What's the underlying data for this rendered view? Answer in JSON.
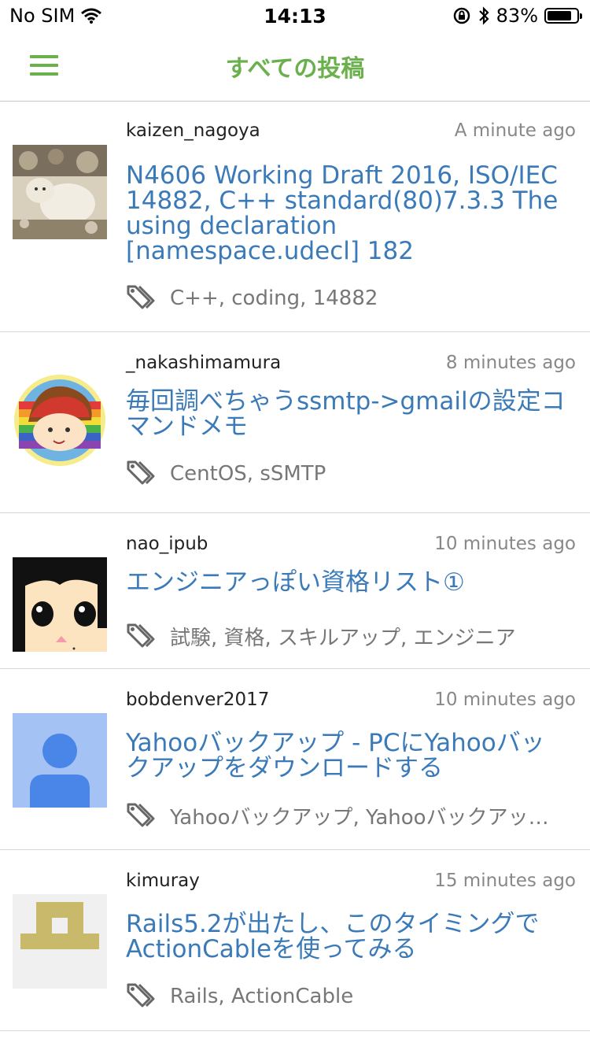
{
  "status": {
    "carrier": "No SIM",
    "time": "14:13",
    "battery": "83%",
    "battery_level": 0.83
  },
  "nav": {
    "title": "すべての投稿"
  },
  "posts": [
    {
      "author": "kaizen_nagoya",
      "time": "A minute ago",
      "title": "N4606 Working Draft 2016, ISO/IEC 14882, C++ standard(80)7.3.3 The using declaration [namespace.udecl] 182",
      "tags": "C++, coding, 14882"
    },
    {
      "author": "_nakashimamura",
      "time": "8 minutes ago",
      "title": "毎回調べちゃうssmtp->gmailの設定コマンドメモ",
      "tags": "CentOS, sSMTP"
    },
    {
      "author": "nao_ipub",
      "time": "10 minutes ago",
      "title": "エンジニアっぽい資格リスト①",
      "tags": "試験, 資格, スキルアップ, エンジニア"
    },
    {
      "author": "bobdenver2017",
      "time": "10 minutes ago",
      "title": "Yahooバックアップ - PCにYahooバックアップをダウンロードする",
      "tags": "Yahooバックアップ, Yahooバックアッ…"
    },
    {
      "author": "kimuray",
      "time": "15 minutes ago",
      "title": "Rails5.2が出たし、このタイミングでActionCableを使ってみる",
      "tags": "Rails, ActionCable"
    }
  ]
}
